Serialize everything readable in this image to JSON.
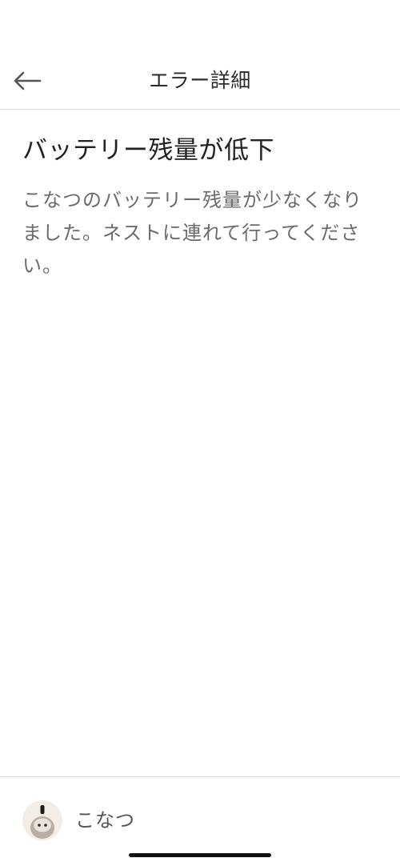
{
  "header": {
    "back_icon": "arrow-left-icon",
    "title": "エラー詳細"
  },
  "error": {
    "title": "バッテリー残量が低下",
    "description": "こなつのバッテリー残量が少なくなりました。ネストに連れて行ってください。"
  },
  "footer": {
    "avatar_icon": "robot-avatar-icon",
    "robot_name": "こなつ"
  },
  "colors": {
    "divider": "#d9d9d9",
    "title_text": "#222222",
    "description_text": "#6b6b6b",
    "avatar_bg": "#f3ede6"
  }
}
